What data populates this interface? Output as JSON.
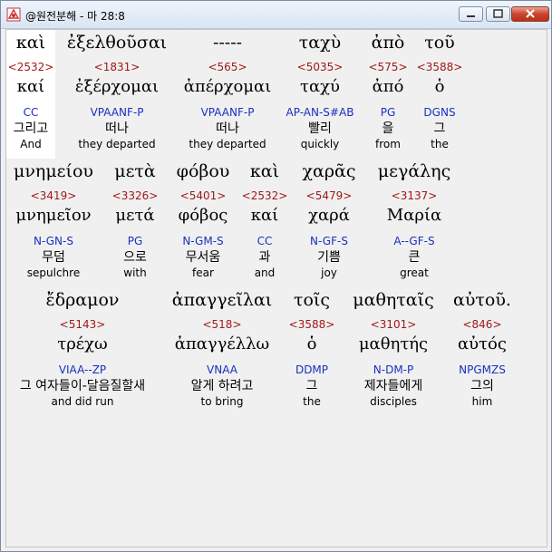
{
  "window": {
    "title": "@원전분해 - 마 28:8",
    "icon": "app-icon"
  },
  "rows": [
    {
      "words": [
        {
          "greek": "καὶ",
          "strong": "<2532>",
          "lemma": "καί",
          "morph": "CC",
          "korean": "그리고",
          "english": "And",
          "selected": true
        },
        {
          "greek": "ἐξελθοῦσαι",
          "strong": "<1831>",
          "lemma": "ἐξέρχομαι",
          "morph": "VPAANF-P",
          "korean": "떠나",
          "english": "they departed"
        },
        {
          "greek": "-----",
          "strong": "<565>",
          "lemma": "ἀπέρχομαι",
          "morph": "VPAANF-P",
          "korean": "떠나",
          "english": "they departed"
        },
        {
          "greek": "ταχὺ",
          "strong": "<5035>",
          "lemma": "ταχύ",
          "morph": "AP-AN-S#AB",
          "korean": "빨리",
          "english": "quickly"
        },
        {
          "greek": "ἀπὸ",
          "strong": "<575>",
          "lemma": "ἀπό",
          "morph": "PG",
          "korean": "을",
          "english": "from"
        },
        {
          "greek": "τοῦ",
          "strong": "<3588>",
          "lemma": "ὁ",
          "morph": "DGNS",
          "korean": "그",
          "english": "the"
        }
      ]
    },
    {
      "words": [
        {
          "greek": "μνημείου",
          "strong": "<3419>",
          "lemma": "μνημεῖον",
          "morph": "N-GN-S",
          "korean": "무덤",
          "english": "sepulchre"
        },
        {
          "greek": "μετὰ",
          "strong": "<3326>",
          "lemma": "μετά",
          "morph": "PG",
          "korean": "으로",
          "english": "with"
        },
        {
          "greek": "φόβου",
          "strong": "<5401>",
          "lemma": "φόβος",
          "morph": "N-GM-S",
          "korean": "무서움",
          "english": "fear"
        },
        {
          "greek": "καὶ",
          "strong": "<2532>",
          "lemma": "καί",
          "morph": "CC",
          "korean": "과",
          "english": "and"
        },
        {
          "greek": "χαρᾶς",
          "strong": "<5479>",
          "lemma": "χαρά",
          "morph": "N-GF-S",
          "korean": "기쁨",
          "english": "joy"
        },
        {
          "greek": "μεγάλης",
          "strong": "<3137>",
          "lemma": "Μαρία",
          "morph": "A--GF-S",
          "korean": "큰",
          "english": "great"
        }
      ]
    },
    {
      "words": [
        {
          "greek": "ἔδραμον",
          "strong": "<5143>",
          "lemma": "τρέχω",
          "morph": "VIAA--ZP",
          "korean": "그 여자들이-달음질할새",
          "english": "and did run"
        },
        {
          "greek": "ἀπαγγεῖλαι",
          "strong": "<518>",
          "lemma": "ἀπαγγέλλω",
          "morph": "VNAA",
          "korean": "알게 하려고",
          "english": "to bring"
        },
        {
          "greek": "τοῖς",
          "strong": "<3588>",
          "lemma": "ὁ",
          "morph": "DDMP",
          "korean": "그",
          "english": "the"
        },
        {
          "greek": "μαθηταῖς",
          "strong": "<3101>",
          "lemma": "μαθητής",
          "morph": "N-DM-P",
          "korean": "제자들에게",
          "english": "disciples"
        },
        {
          "greek": "αὐτοῦ.",
          "strong": "<846>",
          "lemma": "αὐτός",
          "morph": "NPGMZS",
          "korean": "그의",
          "english": "him"
        }
      ]
    }
  ]
}
